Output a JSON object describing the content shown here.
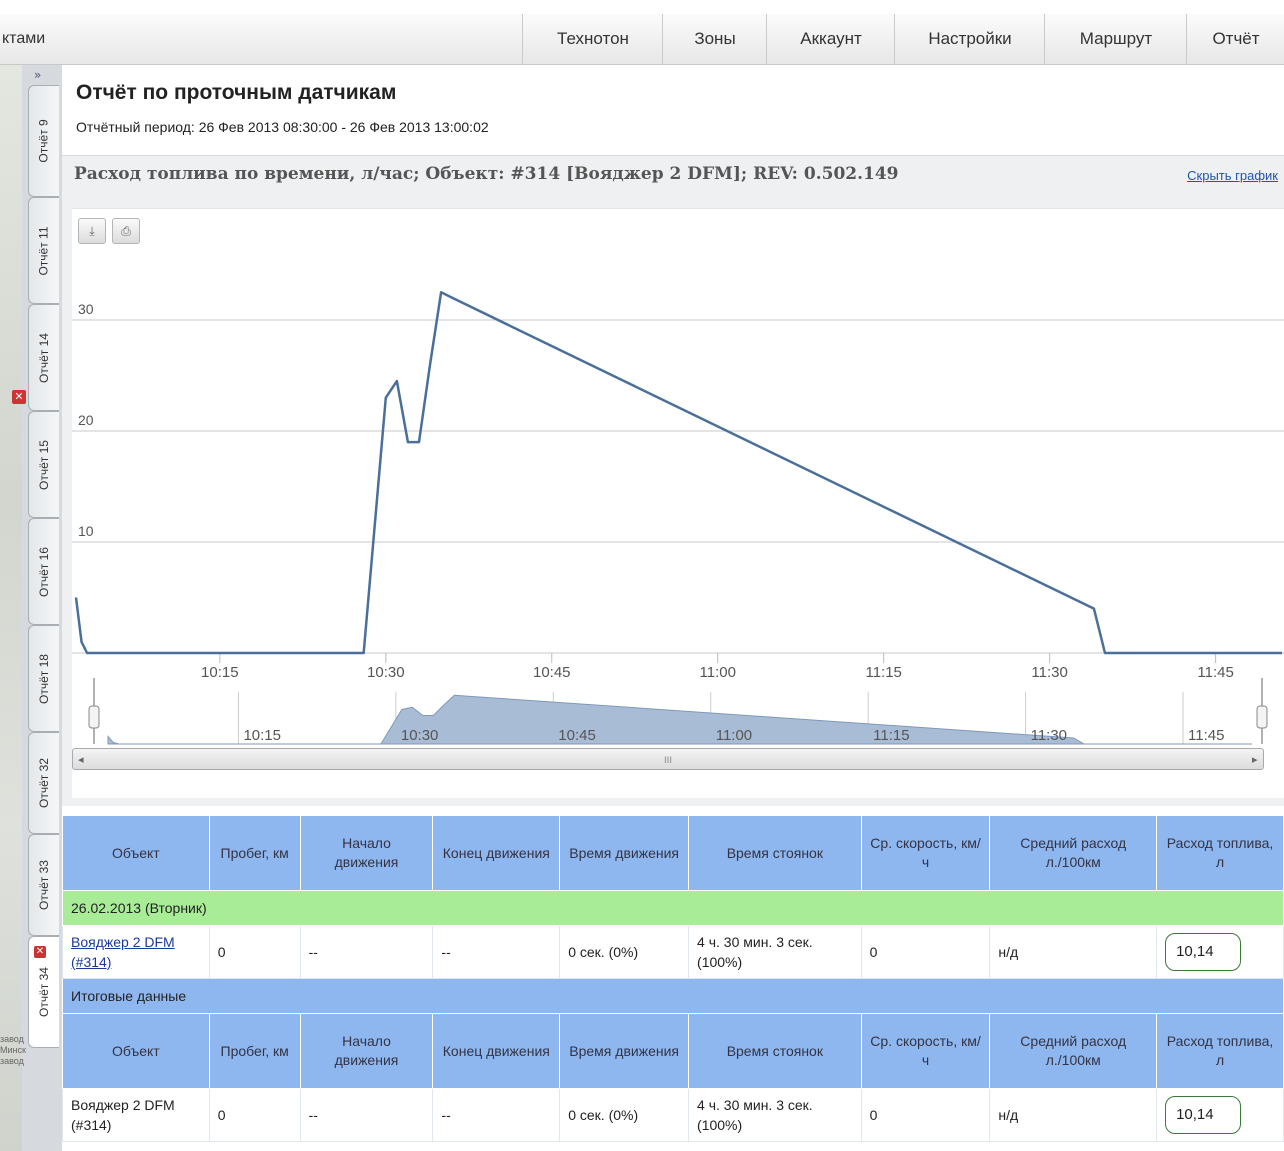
{
  "top_partial": "",
  "topbar": {
    "left_text": "ктами",
    "nav": [
      "Технотон",
      "Зоны",
      "Аккаунт",
      "Настройки",
      "Маршрут",
      "Отчёт"
    ]
  },
  "sidebar": {
    "expand": "»",
    "tabs": [
      "Отчёт 9",
      "Отчёт 11",
      "Отчёт 14",
      "Отчёт 15",
      "Отчёт 16",
      "Отчёт 18",
      "Отчёт 32",
      "Отчёт 33",
      "Отчёт 34"
    ],
    "map_labels": [
      "завод",
      "Минск",
      "завод"
    ]
  },
  "report": {
    "title": "Отчёт по проточным датчикам",
    "period": "Отчётный период: 26 Фев 2013 08:30:00 - 26 Фев 2013 13:00:02",
    "chart_title": "Расход топлива по времени, л/час; Объект: #314 [Вояджер 2 DFM]; REV: 0.502.149",
    "hide_chart": "Скрыть график"
  },
  "toolbar": {
    "download_icon": "download-icon",
    "print_icon": "print-icon"
  },
  "chart_data": {
    "type": "line",
    "title": "Расход топлива по времени, л/час",
    "y_ticks": [
      "10",
      "20",
      "30"
    ],
    "x_ticks": [
      "10:15",
      "10:30",
      "10:45",
      "11:00",
      "11:15",
      "11:30",
      "11:45"
    ],
    "ylim": [
      0,
      35
    ],
    "series": [
      {
        "name": "",
        "color": "#4a6f99",
        "x": [
          "10:02",
          "10:02:30",
          "10:03",
          "10:28",
          "10:30",
          "10:31",
          "10:32",
          "10:33",
          "10:34",
          "10:35",
          "10:36",
          "11:34",
          "11:35",
          "11:51"
        ],
        "values": [
          5,
          1,
          0,
          0,
          23,
          24.5,
          19,
          19,
          26,
          32.5,
          32,
          4,
          0,
          0
        ]
      }
    ],
    "navigator": {
      "x_ticks": [
        "10:15",
        "10:30",
        "10:45",
        "11:00",
        "11:15",
        "11:30",
        "11:45"
      ],
      "scroll_marker": "III"
    },
    "grid": true
  },
  "table": {
    "headers": [
      "Объект",
      "Пробег, км",
      "Начало движения",
      "Конец движения",
      "Время движения",
      "Время стоянок",
      "Ср. скорость, км/ч",
      "Средний расход л./100км",
      "Расход топлива, л"
    ],
    "group_row": "26.02.2013 (Вторник)",
    "row": {
      "object": "Вояджер 2 DFM (#314)",
      "mileage": "0",
      "start": "--",
      "end": "--",
      "move_time": "0 сек. (0%)",
      "stop_time": "4 ч. 30 мин. 3 сек. (100%)",
      "avg_speed": "0",
      "avg_consumption": "н/д",
      "fuel": "10,14"
    },
    "summary_label": "Итоговые данные",
    "summary_row": {
      "object": "Вояджер 2 DFM (#314)",
      "mileage": "0",
      "start": "--",
      "end": "--",
      "move_time": "0 сек. (0%)",
      "stop_time": "4 ч. 30 мин. 3 сек. (100%)",
      "avg_speed": "0",
      "avg_consumption": "н/д",
      "fuel": "10,14"
    }
  }
}
